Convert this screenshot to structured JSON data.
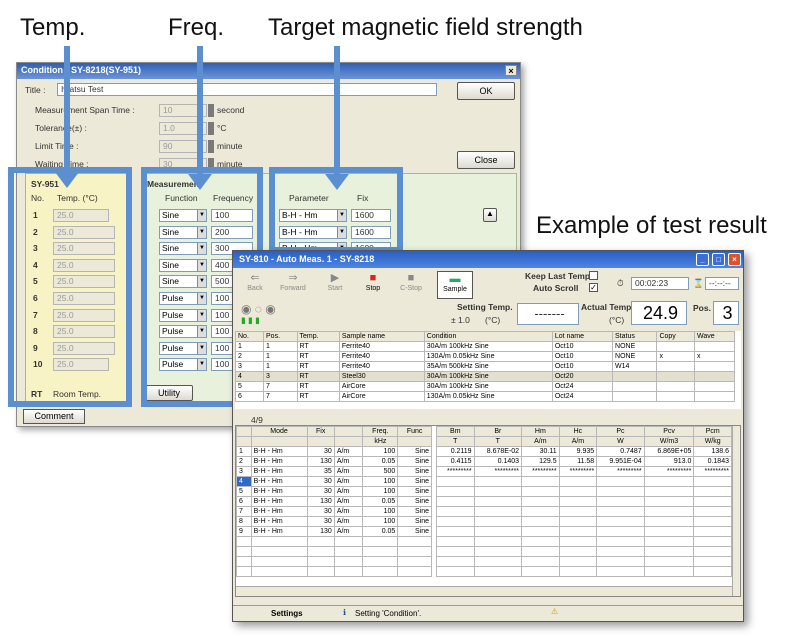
{
  "callouts": {
    "temp": "Temp.",
    "freq": "Freq.",
    "target": "Target magnetic field strength",
    "example": "Example of test result"
  },
  "condition": {
    "title_bar": "Condition - SY-8218(SY-951)",
    "title_label": "Title :",
    "title_value": "Iwatsu Test",
    "ok": "OK",
    "span_label": "Measurement Span Time :",
    "span_value": "10",
    "span_unit": "second",
    "tol_label": "Tolerance(±) :",
    "tol_value": "1.0",
    "tol_unit": "°C",
    "limit_label": "Limit Time :",
    "limit_value": "90",
    "limit_unit": "minute",
    "wait_label": "Waiting Time :",
    "wait_value": "30",
    "wait_unit": "minute",
    "close": "Close",
    "sy_label": "SY-951",
    "no_hdr": "No.",
    "temp_hdr": "Temp. (°C)",
    "meas_label": "Measurement",
    "func_hdr": "Function",
    "freq_hdr": "Frequency",
    "param_hdr": "Parameter",
    "fix_hdr": "Fix",
    "rt_label": "RT",
    "rt_text": "Room Temp.",
    "utility": "Utility",
    "comment": "Comment",
    "rows": [
      {
        "no": "1",
        "temp": "25.0",
        "func": "Sine",
        "freq": "100",
        "param": "B-H - Hm",
        "fix": "1600"
      },
      {
        "no": "2",
        "temp": "25.0",
        "func": "Sine",
        "freq": "200",
        "param": "B-H - Hm",
        "fix": "1600"
      },
      {
        "no": "3",
        "temp": "25.0",
        "func": "Sine",
        "freq": "300",
        "param": "B-H - Hm",
        "fix": "1600"
      },
      {
        "no": "4",
        "temp": "25.0",
        "func": "Sine",
        "freq": "400",
        "param": "",
        "fix": ""
      },
      {
        "no": "5",
        "temp": "25.0",
        "func": "Sine",
        "freq": "500",
        "param": "",
        "fix": ""
      },
      {
        "no": "6",
        "temp": "25.0",
        "func": "Pulse",
        "freq": "100",
        "param": "",
        "fix": ""
      },
      {
        "no": "7",
        "temp": "25.0",
        "func": "Pulse",
        "freq": "100",
        "param": "",
        "fix": ""
      },
      {
        "no": "8",
        "temp": "25.0",
        "func": "Pulse",
        "freq": "100",
        "param": "",
        "fix": ""
      },
      {
        "no": "9",
        "temp": "25.0",
        "func": "Pulse",
        "freq": "100",
        "param": "",
        "fix": ""
      },
      {
        "no": "10",
        "temp": "25.0",
        "func": "Pulse",
        "freq": "100",
        "param": "",
        "fix": ""
      }
    ]
  },
  "result": {
    "title_bar": "SY-810 - Auto Meas. 1 - SY-8218",
    "tb": {
      "back": "Back",
      "forward": "Forward",
      "start": "Start",
      "stop": "Stop",
      "cstop": "C-Stop",
      "sample": "Sample"
    },
    "keep_last": "Keep Last Temp.",
    "auto_scroll": "Auto Scroll",
    "auto_scroll_check": "✓",
    "timer": "00:02:23",
    "timer2": "--:--:--",
    "setting_temp_label": "Setting Temp.",
    "setting_temp_tol": "± 1.0",
    "setting_temp_unit": "(°C)",
    "setting_temp_value": "-------",
    "actual_temp_label": "Actual Temp.",
    "actual_temp_unit": "(°C)",
    "actual_temp_value": "24.9",
    "pos_label": "Pos.",
    "pos_value": "3",
    "top_headers": [
      "No.",
      "Pos.",
      "Temp.",
      "Sample name",
      "Condition",
      "Lot name",
      "Status",
      "Copy",
      "Wave"
    ],
    "top_rows": [
      [
        "1",
        "1",
        "RT",
        "Ferrite40",
        "30A/m  100kHz  Sine",
        "Oct10",
        "NONE",
        "",
        ""
      ],
      [
        "2",
        "1",
        "RT",
        "Ferrite40",
        "130A/m  0.05kHz  Sine",
        "Oct10",
        "NONE",
        "x",
        "x"
      ],
      [
        "3",
        "1",
        "RT",
        "Ferrite40",
        "35A/m  500kHz  Sine",
        "Oct10",
        "W14",
        "",
        ""
      ],
      [
        "4",
        "3",
        "RT",
        "Steel30",
        "30A/m  100kHz  Sine",
        "Oct20",
        "",
        "",
        ""
      ],
      [
        "5",
        "7",
        "RT",
        "AirCore",
        "30A/m  100kHz  Sine",
        "Oct24",
        "",
        "",
        ""
      ],
      [
        "6",
        "7",
        "RT",
        "AirCore",
        "130A/m  0.05kHz  Sine",
        "Oct24",
        "",
        "",
        ""
      ]
    ],
    "counter": "4/9",
    "left_headers": [
      "",
      "Mode",
      "Fix",
      "",
      "Freq.",
      "Func"
    ],
    "left_units": [
      "",
      "",
      "",
      "",
      "kHz",
      ""
    ],
    "left_rows": [
      [
        "1",
        "B-H - Hm",
        "30",
        "A/m",
        "100",
        "Sine"
      ],
      [
        "2",
        "B-H - Hm",
        "130",
        "A/m",
        "0.05",
        "Sine"
      ],
      [
        "3",
        "B-H - Hm",
        "35",
        "A/m",
        "500",
        "Sine"
      ],
      [
        "4",
        "B-H - Hm",
        "30",
        "A/m",
        "100",
        "Sine"
      ],
      [
        "5",
        "B-H - Hm",
        "30",
        "A/m",
        "100",
        "Sine"
      ],
      [
        "6",
        "B-H - Hm",
        "130",
        "A/m",
        "0.05",
        "Sine"
      ],
      [
        "7",
        "B-H - Hm",
        "30",
        "A/m",
        "100",
        "Sine"
      ],
      [
        "8",
        "B-H - Hm",
        "30",
        "A/m",
        "100",
        "Sine"
      ],
      [
        "9",
        "B-H - Hm",
        "130",
        "A/m",
        "0.05",
        "Sine"
      ]
    ],
    "right_headers": [
      "Bm",
      "Br",
      "Hm",
      "Hc",
      "Pc",
      "Pcv",
      "Pcm"
    ],
    "right_units": [
      "T",
      "T",
      "A/m",
      "A/m",
      "W",
      "W/m3",
      "W/kg"
    ],
    "right_rows": [
      [
        "0.2119",
        "8.678E-02",
        "30.11",
        "9.935",
        "0.7487",
        "6.869E+05",
        "138.6"
      ],
      [
        "0.4115",
        "0.1403",
        "129.5",
        "11.58",
        "9.951E-04",
        "913.0",
        "0.1843"
      ],
      [
        "*********",
        "*********",
        "*********",
        "*********",
        "*********",
        "*********",
        "*********"
      ]
    ],
    "status_settings": "Settings",
    "status_msg": "Setting 'Condition'."
  }
}
